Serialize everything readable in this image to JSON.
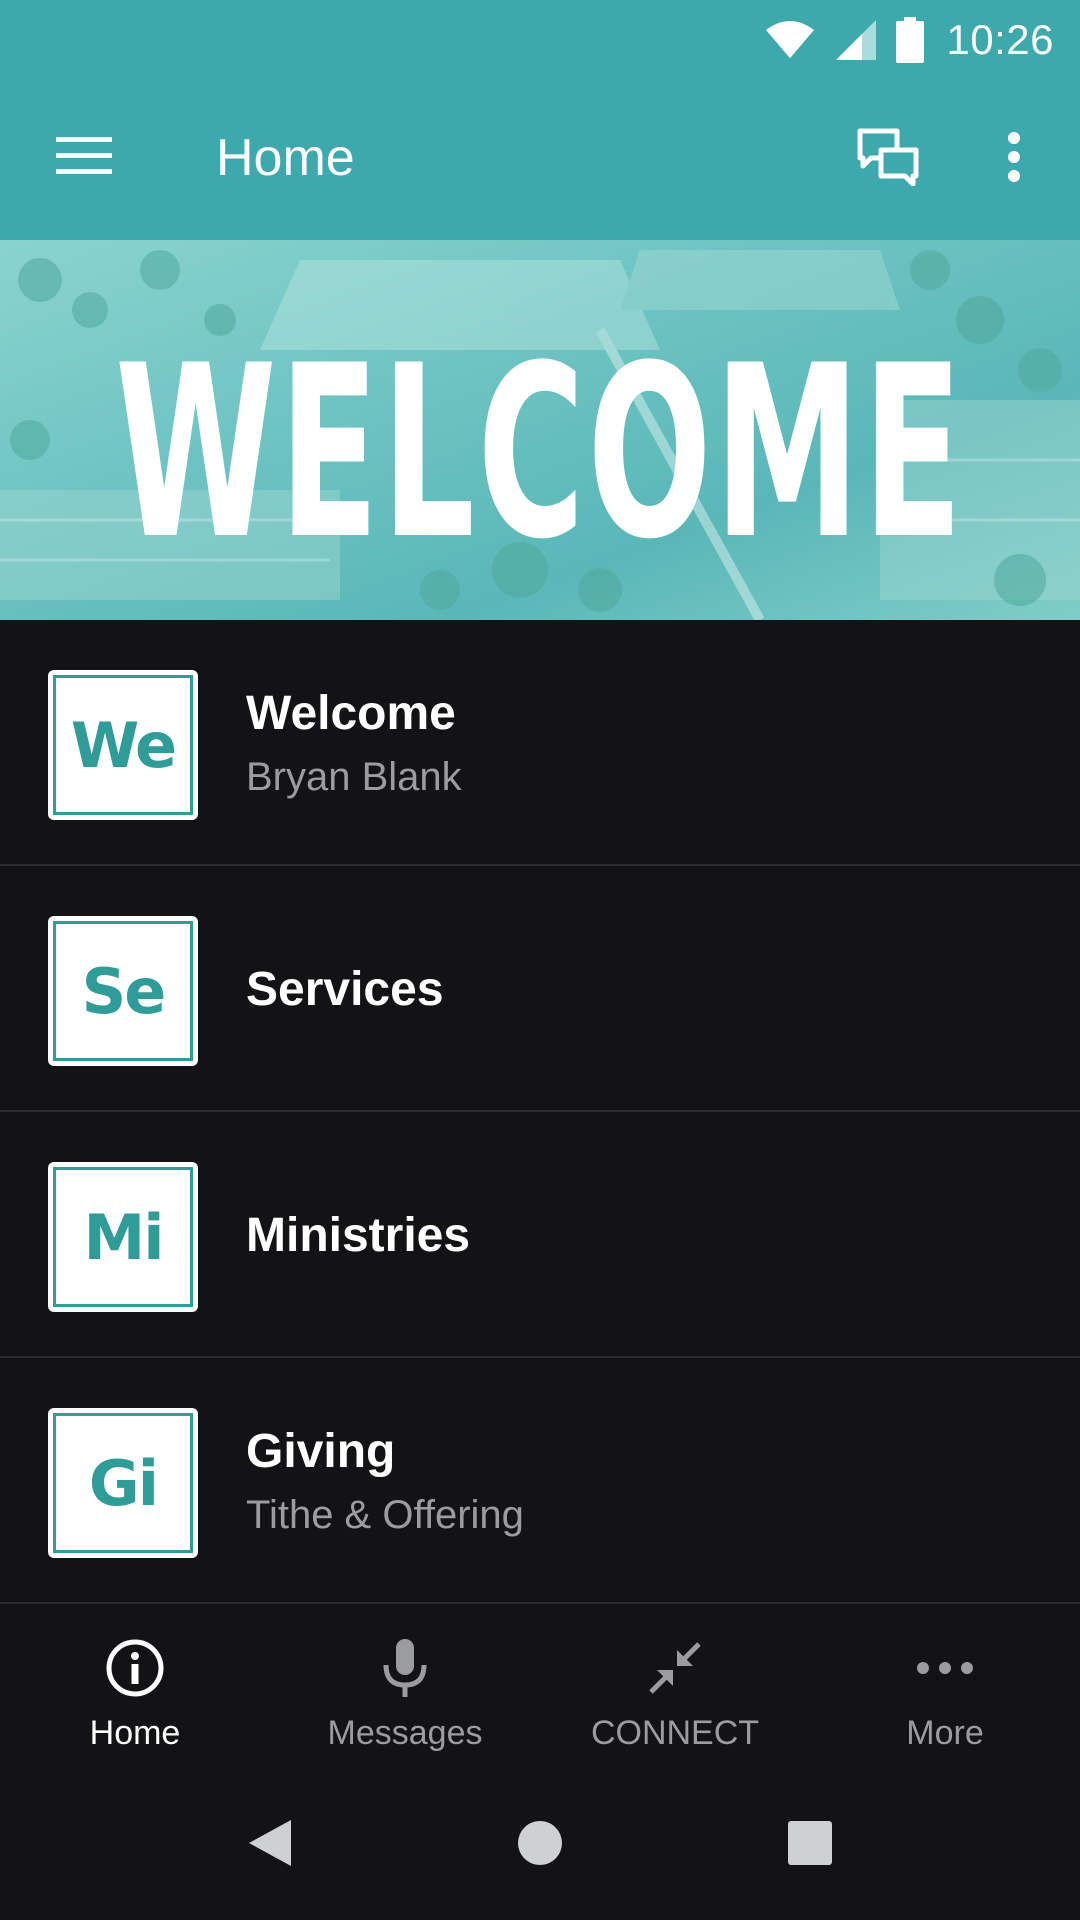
{
  "status_bar": {
    "time": "10:26",
    "icons": [
      "wifi-icon",
      "signal-icon",
      "battery-icon"
    ]
  },
  "app_bar": {
    "title": "Home",
    "menu_icon": "hamburger-menu-icon",
    "chat_icon": "chat-bubbles-icon",
    "overflow_icon": "more-vert-icon"
  },
  "banner": {
    "text": "WELCOME"
  },
  "list": {
    "items": [
      {
        "abbr": "We",
        "title": "Welcome",
        "subtitle": "Bryan Blank"
      },
      {
        "abbr": "Se",
        "title": "Services",
        "subtitle": ""
      },
      {
        "abbr": "Mi",
        "title": "Ministries",
        "subtitle": ""
      },
      {
        "abbr": "Gi",
        "title": "Giving",
        "subtitle": "Tithe & Offering"
      }
    ]
  },
  "bottom_nav": {
    "tabs": [
      {
        "label": "Home",
        "icon": "info-icon",
        "active": true
      },
      {
        "label": "Messages",
        "icon": "microphone-icon",
        "active": false
      },
      {
        "label": "CONNECT",
        "icon": "compress-arrows-icon",
        "active": false
      },
      {
        "label": "More",
        "icon": "more-horiz-icon",
        "active": false
      }
    ]
  },
  "system_nav": {
    "icons": [
      "back-icon",
      "home-circle-icon",
      "recents-icon"
    ]
  },
  "colors": {
    "primary": "#3ea9ad",
    "background": "#131316",
    "accent_teal": "#2f9c98",
    "secondary_text": "#9b9ca0"
  }
}
